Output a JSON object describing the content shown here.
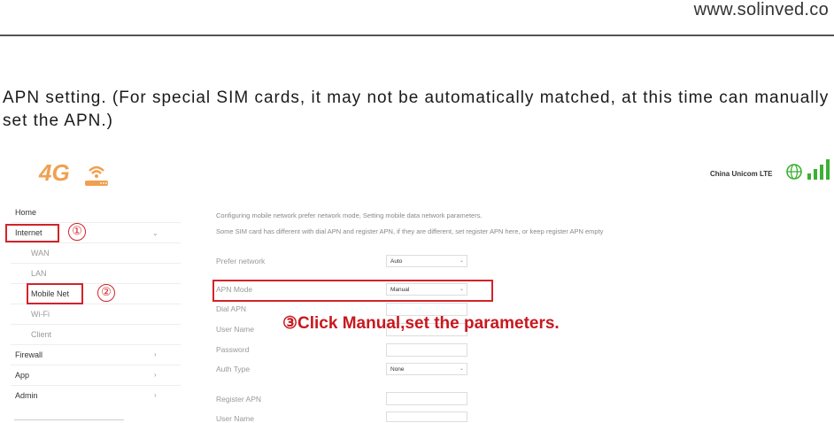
{
  "header": {
    "site_url": "www.solinved.co"
  },
  "intro": {
    "text": "APN setting. (For special SIM cards, it may not be automatically matched, at this time can manually set the APN.)"
  },
  "app": {
    "logo_text": "4G",
    "carrier": "China Unicom LTE",
    "accent_color": "#f0a050",
    "highlight_color": "#d2232a"
  },
  "sidebar": {
    "items": [
      {
        "label": "Home"
      },
      {
        "label": "Internet",
        "chevron": "⌄"
      },
      {
        "label": "WAN"
      },
      {
        "label": "LAN"
      },
      {
        "label": "Mobile Net"
      },
      {
        "label": "Wi-Fi"
      },
      {
        "label": "Client"
      },
      {
        "label": "Firewall",
        "chevron": "›"
      },
      {
        "label": "App",
        "chevron": "›"
      },
      {
        "label": "Admin",
        "chevron": "›"
      }
    ]
  },
  "markers": {
    "m1": "①",
    "m2": "②"
  },
  "main": {
    "desc1": "Configuring mobile network prefer network mode, Setting mobile data network parameters.",
    "desc2": "Some SIM card has different with dial APN and register APN, if they are different, set register APN here, or keep register APN empty",
    "fields": {
      "prefer_network": {
        "label": "Prefer network",
        "value": "Auto"
      },
      "apn_mode": {
        "label": "APN Mode",
        "value": "Manual"
      },
      "dial_apn": {
        "label": "Dial APN"
      },
      "user_name": {
        "label": "User Name"
      },
      "password": {
        "label": "Password"
      },
      "auth_type": {
        "label": "Auth Type",
        "value": "None"
      },
      "register_apn": {
        "label": "Register APN"
      },
      "user_name_2": {
        "label": "User Name"
      }
    },
    "select_chevron": "⌄"
  },
  "annotation": {
    "text": "③Click Manual,set the parameters."
  }
}
